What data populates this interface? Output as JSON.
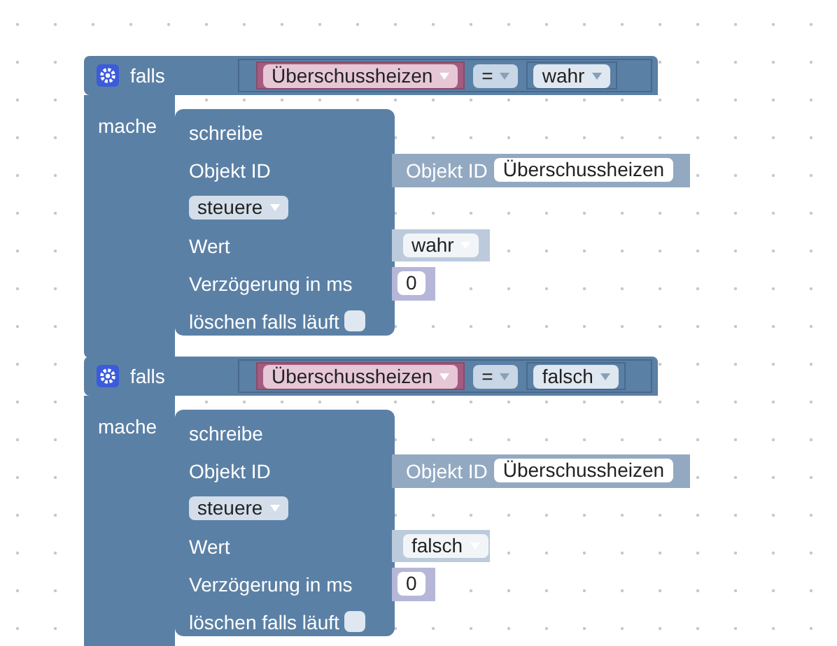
{
  "blocks": [
    {
      "if_label": "falls",
      "do_label": "mache",
      "variable": "Überschussheizen",
      "operator": "=",
      "compare_value": "wahr",
      "action": {
        "title": "schreibe",
        "object_label": "Objekt ID",
        "object_field_label": "Objekt ID",
        "object_value": "Überschussheizen",
        "mode": "steuere",
        "value_label": "Wert",
        "value": "wahr",
        "delay_label": "Verzögerung in ms",
        "delay": "0",
        "clear_label": "löschen falls läuft",
        "clear_running": false
      }
    },
    {
      "if_label": "falls",
      "do_label": "mache",
      "variable": "Überschussheizen",
      "operator": "=",
      "compare_value": "falsch",
      "action": {
        "title": "schreibe",
        "object_label": "Objekt ID",
        "object_field_label": "Objekt ID",
        "object_value": "Überschussheizen",
        "mode": "steuere",
        "value_label": "Wert",
        "value": "falsch",
        "delay_label": "Verzögerung in ms",
        "delay": "0",
        "clear_label": "löschen falls läuft",
        "clear_running": false
      }
    }
  ]
}
